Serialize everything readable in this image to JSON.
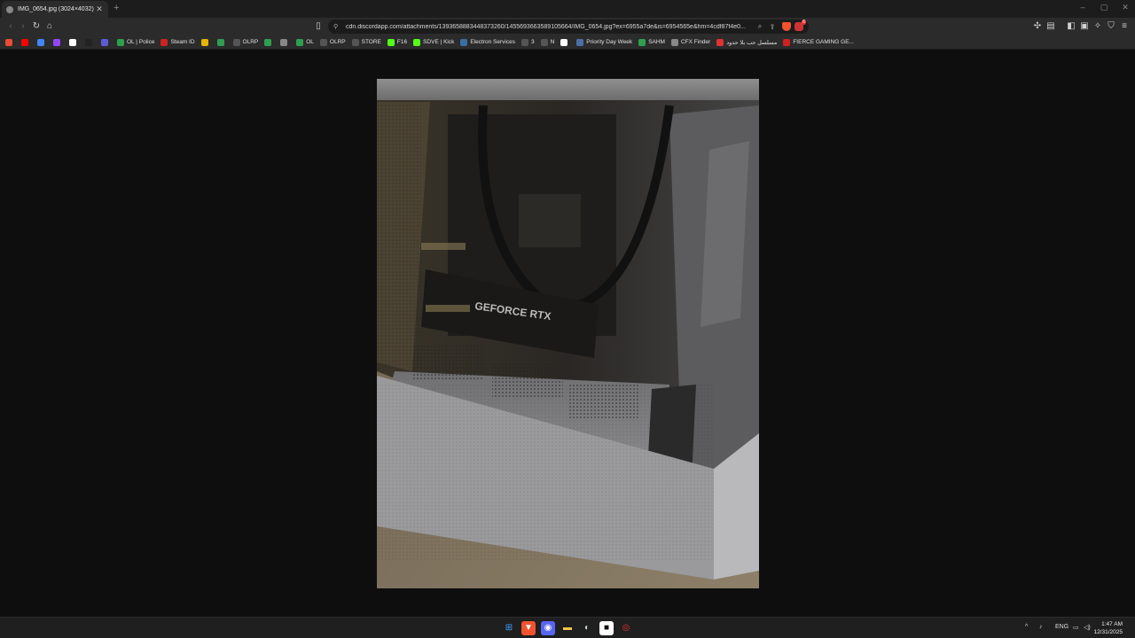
{
  "tab": {
    "title": "IMG_0654.jpg (3024×4032)",
    "close": "✕",
    "new": "+"
  },
  "window_controls": [
    "–",
    "▢",
    "✕"
  ],
  "toolbar": {
    "url": "cdn.discordapp.com/attachments/1393658883448373260/1455693663589105664/IMG_0654.jpg?ex=6955a7de&is=6954565e&hm=4cdf87f4e0...",
    "rewards_badge": "6"
  },
  "bookmarks": [
    {
      "label": "",
      "color": "#e94b35"
    },
    {
      "label": "",
      "color": "#ff0000"
    },
    {
      "label": "",
      "color": "#4285f4"
    },
    {
      "label": "",
      "color": "#9146ff"
    },
    {
      "label": "",
      "color": "#ffffff"
    },
    {
      "label": "",
      "color": "#222222"
    },
    {
      "label": "",
      "color": "#5b5bd6"
    },
    {
      "label": "OL | Police",
      "color": "#2e9e4f"
    },
    {
      "label": "Steam ID",
      "color": "#c22"
    },
    {
      "label": "",
      "color": "#e5b400"
    },
    {
      "label": "",
      "color": "#2e9e4f"
    },
    {
      "label": "OLRP",
      "color": "#555"
    },
    {
      "label": "",
      "color": "#2e9e4f"
    },
    {
      "label": "",
      "color": "#888"
    },
    {
      "label": "OL",
      "color": "#2e9e4f"
    },
    {
      "label": "OLRP",
      "color": "#555"
    },
    {
      "label": "STORE",
      "color": "#555"
    },
    {
      "label": "F16",
      "color": "#53fc18"
    },
    {
      "label": "SDVE | Kick",
      "color": "#53fc18"
    },
    {
      "label": "Electron Services",
      "color": "#3a6ea5"
    },
    {
      "label": "3",
      "color": "#555"
    },
    {
      "label": "N",
      "color": "#555"
    },
    {
      "label": "",
      "color": "#ffffff"
    },
    {
      "label": "Priority Day Week",
      "color": "#4a6fa5"
    },
    {
      "label": "SAHM",
      "color": "#2e9e4f"
    },
    {
      "label": "CFX Finder",
      "color": "#888"
    },
    {
      "label": "مسلسل حب بلا حدود",
      "color": "#d33"
    },
    {
      "label": "FIERCE GAMING GE...",
      "color": "#c22"
    }
  ],
  "photo_text": "GEFORCE RTX",
  "taskbar": {
    "lang": "ENG",
    "time": "1:47 AM",
    "date": "12/31/2025"
  },
  "colors": {
    "background": "#0e0e0e",
    "chrome": "#2b2b2b",
    "accent_brave": "#f0532e"
  },
  "icons": {
    "back": "back-arrow-icon",
    "forward": "forward-arrow-icon",
    "reload": "reload-icon",
    "home": "home-icon",
    "bookmark": "bookmark-icon",
    "menu": "hamburger-menu-icon"
  }
}
